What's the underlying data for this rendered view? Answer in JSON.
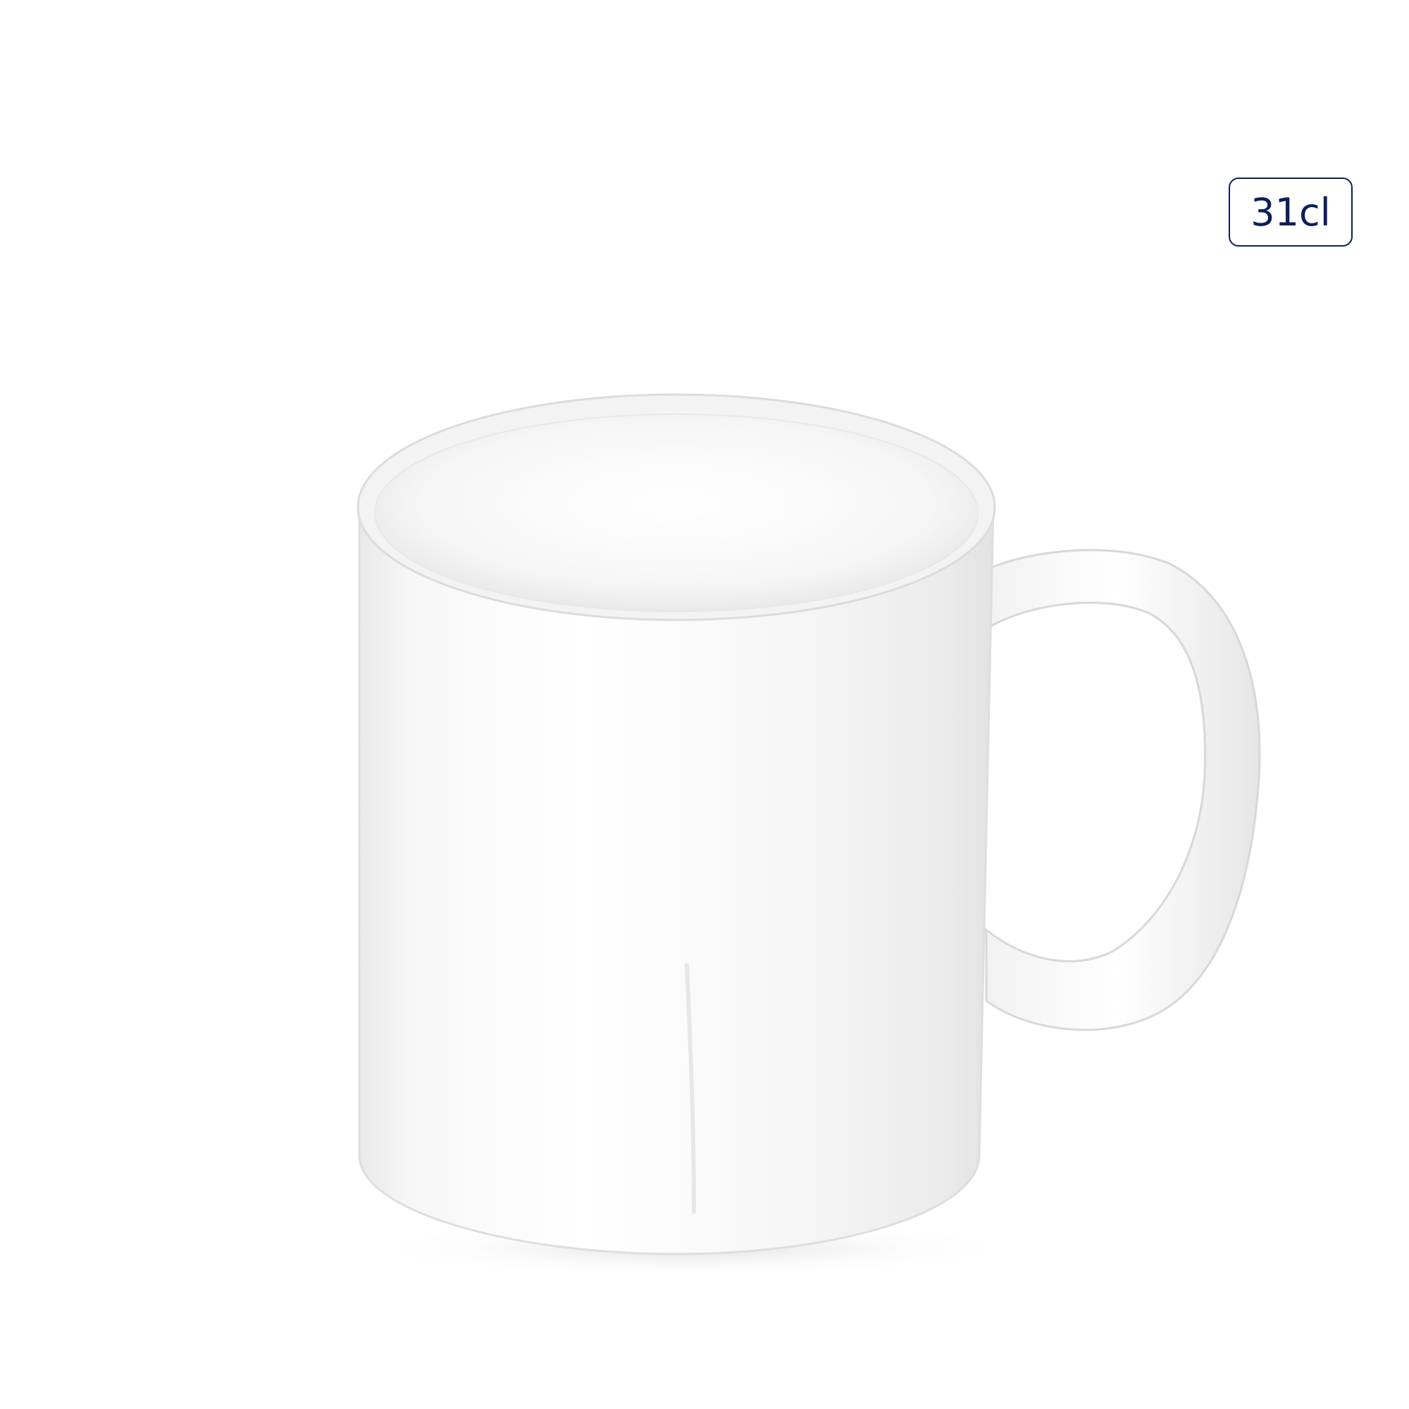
{
  "badge": {
    "capacity_label": "31cl",
    "color": "#0b1f5c"
  },
  "image": {
    "subject_icon": "white-mug-icon",
    "background_color": "#ffffff"
  }
}
